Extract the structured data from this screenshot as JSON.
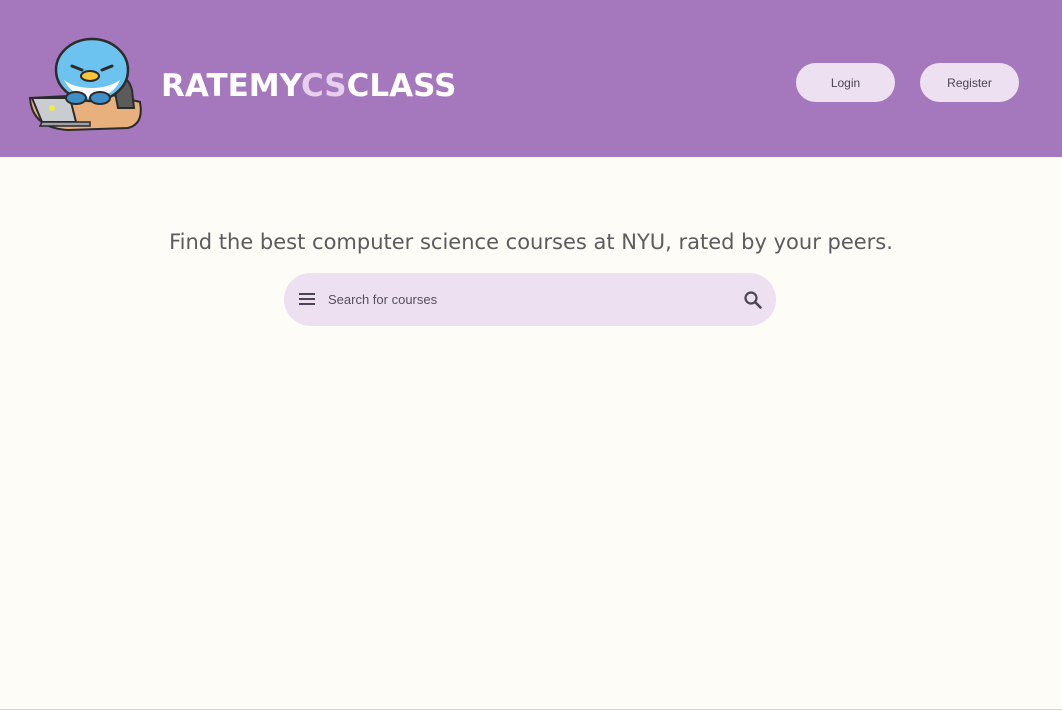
{
  "header": {
    "logo_text_part1": "RATEMY",
    "logo_text_accent": "CS",
    "logo_text_part2": "CLASS",
    "login_label": "Login",
    "register_label": "Register",
    "background_color": "#a577bd",
    "button_color": "#ece0f1"
  },
  "main": {
    "tagline": "Find the best computer science courses at NYU, rated by your peers.",
    "search": {
      "placeholder": "Search for courses",
      "value": "",
      "leading_icon": "menu-icon",
      "trailing_icon": "search-icon"
    },
    "background_color": "#fefcf6"
  }
}
